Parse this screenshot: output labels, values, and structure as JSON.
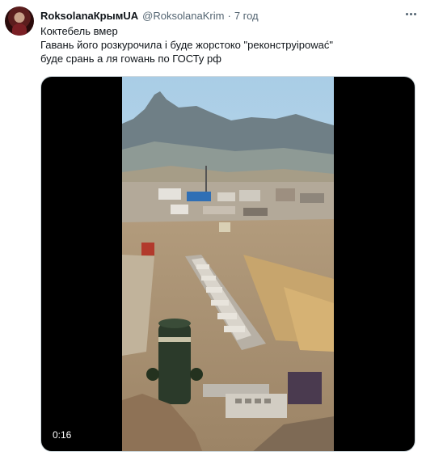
{
  "tweet": {
    "author": {
      "display_name": "RoksolanaКрымUA",
      "handle": "@RoksolanaKrim",
      "separator": "·",
      "time": "7 год"
    },
    "text_lines": [
      "Коктебель вмер",
      "Гавань його розкурочила і буде жорстоко \"реконструірować\"",
      "буде срань а ля гowань по ГОСТу рф"
    ],
    "media": {
      "type": "video",
      "duration": "0:16"
    }
  },
  "icons": {
    "more": "more-horizontal-icon"
  }
}
